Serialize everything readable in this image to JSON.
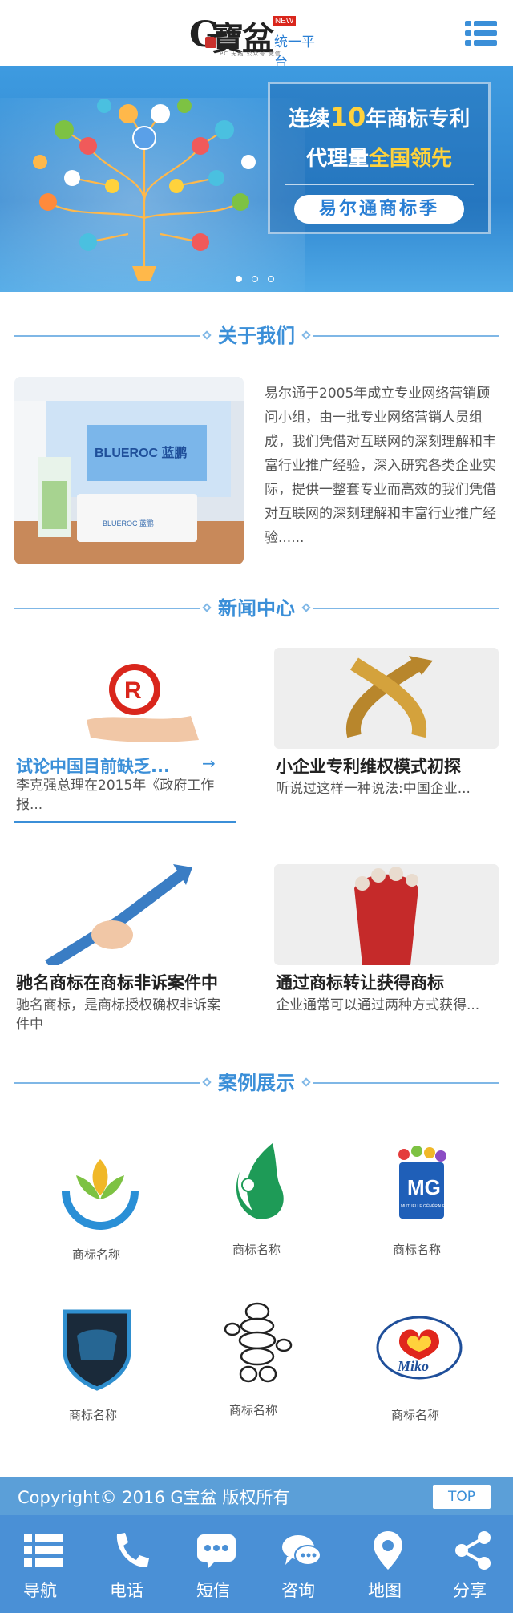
{
  "header": {
    "logo_g": "G",
    "logo_chars": "寶盆",
    "logo_new": "NEW",
    "logo_tagline": "统一平台",
    "logo_sub": "PC 无线 公众号 微信"
  },
  "banner": {
    "line1_pre": "连续",
    "line1_num": "10",
    "line1_post": "年商标专利",
    "line2_pre": "代理量",
    "line2_highlight": "全国领先",
    "pill": "易尔通商标季"
  },
  "about": {
    "title": "关于我们",
    "sign_text": "BLUEROC 蓝鹏",
    "desk_text": "BLUEROC 蓝鹏",
    "text": "易尔通于2005年成立专业网络营销顾问小组，由一批专业网络营销人员组成，我们凭借对互联网的深刻理解和丰富行业推广经验，深入研究各类企业实际，提供一整套专业而高效的我们凭借对互联网的深刻理解和丰富行业推广经验......"
  },
  "news": {
    "title": "新闻中心",
    "items": [
      {
        "title": "试论中国目前缺乏...",
        "desc": "李克强总理在2015年《政府工作报..."
      },
      {
        "title": "小企业专利维权模式初探",
        "desc": "听说过这样一种说法:中国企业..."
      },
      {
        "title": "驰名商标在商标非诉案件中",
        "desc": "驰名商标，是商标授权确权非诉案件中"
      },
      {
        "title": "通过商标转让获得商标",
        "desc": "企业通常可以通过两种方式获得..."
      }
    ],
    "arrow": "→"
  },
  "cases": {
    "title": "案例展示",
    "items": [
      {
        "name": "商标名称"
      },
      {
        "name": "商标名称"
      },
      {
        "name": "商标名称",
        "logo_text": "MG",
        "logo_sub": "MUTUELLE GÉNÉRALE"
      },
      {
        "name": "商标名称"
      },
      {
        "name": "商标名称"
      },
      {
        "name": "商标名称",
        "logo_text": "Miko"
      }
    ]
  },
  "footer": {
    "copyright": "Copyright© 2016  G宝盆 版权所有",
    "top": "TOP"
  },
  "bottom_nav": [
    {
      "label": "导航",
      "icon": "grid-menu-icon"
    },
    {
      "label": "电话",
      "icon": "phone-icon"
    },
    {
      "label": "短信",
      "icon": "sms-icon"
    },
    {
      "label": "咨询",
      "icon": "chat-icon"
    },
    {
      "label": "地图",
      "icon": "map-pin-icon"
    },
    {
      "label": "分享",
      "icon": "share-icon"
    }
  ],
  "colors": {
    "accent": "#3b8fd8",
    "nav_bg": "#4a90d6",
    "footer_bg": "#5b9fd8",
    "highlight": "#ffd23c"
  }
}
